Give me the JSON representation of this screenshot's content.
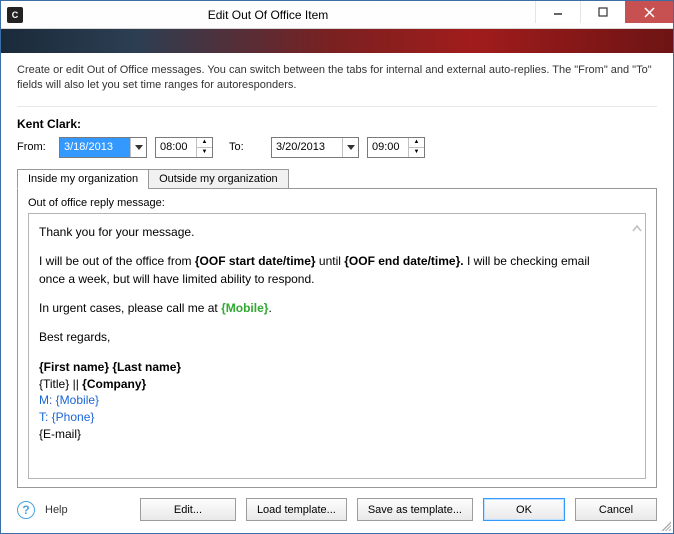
{
  "window_title": "Edit Out Of Office Item",
  "appicon_text": "C",
  "description": "Create or edit Out of Office messages. You can switch between the tabs for internal and external auto-replies. The \"From\" and \"To\" fields will also let you set time ranges for autoresponders.",
  "person": "Kent Clark:",
  "range": {
    "from_label": "From:",
    "from_date": "3/18/2013",
    "from_time": "08:00",
    "to_label": "To:",
    "to_date": "3/20/2013",
    "to_time": "09:00"
  },
  "tabs": {
    "inside": "Inside my organization",
    "outside": "Outside my organization"
  },
  "panel_label": "Out of office reply message:",
  "message": {
    "greeting": "Thank you for your message.",
    "body_pre": "I will be out of the office from ",
    "token_start": "{OOF start date/time}",
    "body_mid": " until ",
    "token_end": "{OOF end date/time}.",
    "body_post": " I will be checking email once a week, but will have limited ability to respond.",
    "urgent_pre": "In urgent cases, please call me at ",
    "token_mobile": "{Mobile}",
    "urgent_post": ".",
    "regards": "Best regards,",
    "sig_name": "{First name} {Last name}",
    "sig_title_pre": "{Title} || ",
    "sig_company": "{Company}",
    "sig_m_pre": "M: ",
    "sig_m": "{Mobile}",
    "sig_t_pre": "T: ",
    "sig_t": "{Phone}",
    "sig_email": "{E-mail}"
  },
  "footer": {
    "help": "Help",
    "edit": "Edit...",
    "load": "Load template...",
    "save": "Save as template...",
    "ok": "OK",
    "cancel": "Cancel"
  }
}
